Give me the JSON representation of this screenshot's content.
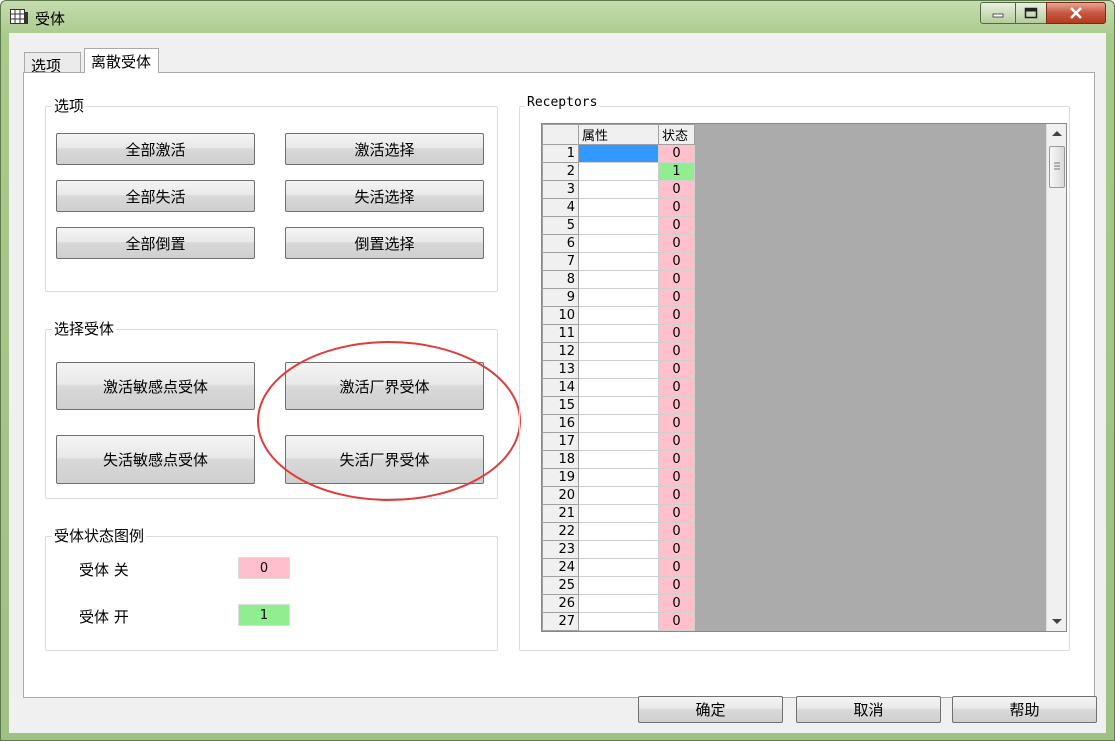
{
  "window": {
    "title": "受体"
  },
  "tabs": [
    {
      "label": "选项"
    },
    {
      "label": "离散受体"
    }
  ],
  "options_group": {
    "title": "选项",
    "buttons": [
      "全部激活",
      "激活选择",
      "全部失活",
      "失活选择",
      "全部倒置",
      "倒置选择"
    ]
  },
  "select_group": {
    "title": "选择受体",
    "buttons": [
      "激活敏感点受体",
      "激活厂界受体",
      "失活敏感点受体",
      "失活厂界受体"
    ]
  },
  "legend_group": {
    "title": "受体状态图例",
    "off_label": "受体 关",
    "off_value": "0",
    "on_label": "受体 开",
    "on_value": "1",
    "off_color": "#ffc0cb",
    "on_color": "#90ee90"
  },
  "receptors": {
    "title": "Receptors",
    "headers": {
      "attribute": "属性",
      "state": "状态"
    },
    "rows": [
      {
        "n": "1",
        "s": "0"
      },
      {
        "n": "2",
        "s": "1"
      },
      {
        "n": "3",
        "s": "0"
      },
      {
        "n": "4",
        "s": "0"
      },
      {
        "n": "5",
        "s": "0"
      },
      {
        "n": "6",
        "s": "0"
      },
      {
        "n": "7",
        "s": "0"
      },
      {
        "n": "8",
        "s": "0"
      },
      {
        "n": "9",
        "s": "0"
      },
      {
        "n": "10",
        "s": "0"
      },
      {
        "n": "11",
        "s": "0"
      },
      {
        "n": "12",
        "s": "0"
      },
      {
        "n": "13",
        "s": "0"
      },
      {
        "n": "14",
        "s": "0"
      },
      {
        "n": "15",
        "s": "0"
      },
      {
        "n": "16",
        "s": "0"
      },
      {
        "n": "17",
        "s": "0"
      },
      {
        "n": "18",
        "s": "0"
      },
      {
        "n": "19",
        "s": "0"
      },
      {
        "n": "20",
        "s": "0"
      },
      {
        "n": "21",
        "s": "0"
      },
      {
        "n": "22",
        "s": "0"
      },
      {
        "n": "23",
        "s": "0"
      },
      {
        "n": "24",
        "s": "0"
      },
      {
        "n": "25",
        "s": "0"
      },
      {
        "n": "26",
        "s": "0"
      },
      {
        "n": "27",
        "s": "0"
      }
    ]
  },
  "footer": {
    "ok": "确定",
    "cancel": "取消",
    "help": "帮助"
  }
}
